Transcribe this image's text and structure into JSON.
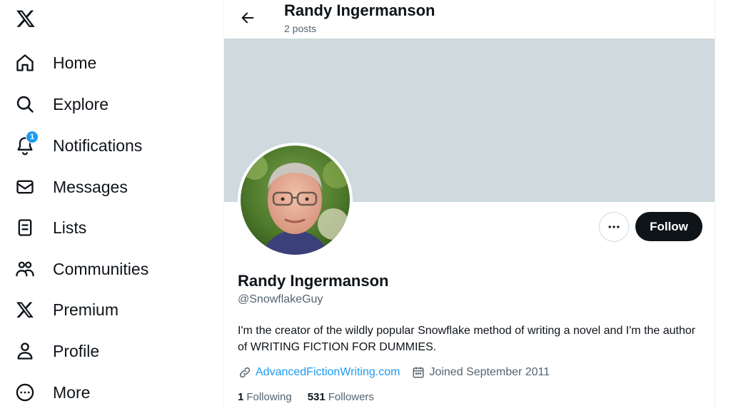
{
  "nav": {
    "items": [
      {
        "label": "Home",
        "icon": "home-icon"
      },
      {
        "label": "Explore",
        "icon": "search-icon"
      },
      {
        "label": "Notifications",
        "icon": "bell-icon",
        "badge": "1"
      },
      {
        "label": "Messages",
        "icon": "envelope-icon"
      },
      {
        "label": "Lists",
        "icon": "list-icon"
      },
      {
        "label": "Communities",
        "icon": "communities-icon"
      },
      {
        "label": "Premium",
        "icon": "x-logo-icon"
      },
      {
        "label": "Profile",
        "icon": "person-icon"
      },
      {
        "label": "More",
        "icon": "more-circle-icon"
      }
    ]
  },
  "header": {
    "name": "Randy Ingermanson",
    "posts": "2 posts"
  },
  "profile": {
    "name": "Randy Ingermanson",
    "handle": "@SnowflakeGuy",
    "bio": "I'm the creator of the wildly popular Snowflake method of writing a novel and I'm the author of WRITING FICTION FOR DUMMIES.",
    "website": "AdvancedFictionWriting.com",
    "joined": "Joined September 2011",
    "following_count": "1",
    "following_label": "Following",
    "followers_count": "531",
    "followers_label": "Followers"
  },
  "actions": {
    "follow_label": "Follow"
  },
  "colors": {
    "accent": "#1d9bf0",
    "banner": "#cfd9de",
    "text": "#0f1419",
    "muted": "#536471"
  }
}
